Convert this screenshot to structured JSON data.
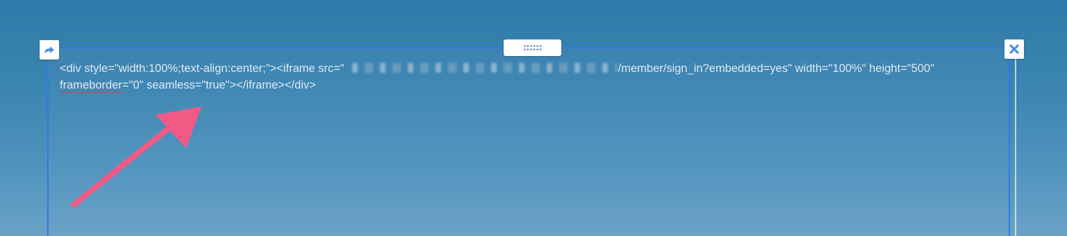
{
  "editor": {
    "code_part1": "<div style=\"width:100%;text-align:center;\"><iframe src=\"",
    "code_part2": "/member/sign_in?embedded=yes\" width=\"100%\" height=\"500\" ",
    "code_underlined": "frameborder",
    "code_part3": "=\"0\" seamless=\"true\"></iframe></div>"
  },
  "icons": {
    "left_corner": "share-arrow-icon",
    "right_corner": "close-icon",
    "handle": "drag-handle-icon",
    "annotation": "annotation-arrow"
  },
  "colors": {
    "frame_border": "#2a7de1",
    "annotation_arrow": "#f25a86",
    "spellcheck_underline": "#e8364a"
  }
}
